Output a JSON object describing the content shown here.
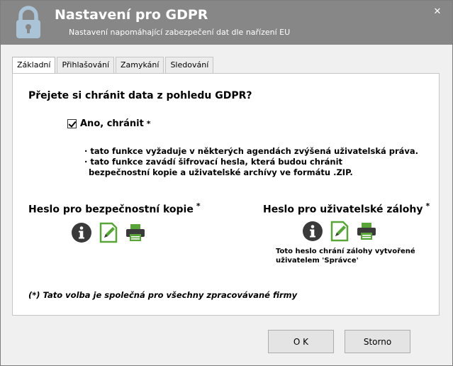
{
  "window": {
    "title": "Nastavení pro GDPR",
    "subtitle": "Nastavení napomáhající zabezpečení dat dle nařízení EU",
    "close_label": "✕"
  },
  "tabs": [
    {
      "label": "Základní",
      "active": true
    },
    {
      "label": "Přihlašování",
      "active": false
    },
    {
      "label": "Zamykání",
      "active": false
    },
    {
      "label": "Sledování",
      "active": false
    }
  ],
  "main": {
    "question": "Přejete si chránit data z pohledu GDPR?",
    "checkbox": {
      "label": "Ano, chránit",
      "checked": true,
      "marker": "*"
    },
    "notes": [
      "· tato funkce vyžaduje v některých agendách zvýšená uživatelská práva.",
      "· tato funkce zavádí šifrovací hesla, která budou chránit",
      "  bezpečnostní kopie a uživatelské archívy ve formátu .ZIP."
    ],
    "backup": {
      "heading": "Heslo pro bezpečnostní kopie",
      "marker": "*"
    },
    "user": {
      "heading": "Heslo pro uživatelské zálohy",
      "marker": "*",
      "note_line1": "Toto heslo chrání zálohy vytvořené",
      "note_line2": "uživatelem  'Správce'"
    },
    "footnote": "(*) Tato volba je společná pro všechny zpracovávané firmy"
  },
  "buttons": {
    "ok": "O K",
    "cancel": "Storno"
  },
  "icons": {
    "lock": "lock-icon",
    "info": "info-icon",
    "edit": "edit-icon",
    "print": "print-icon"
  },
  "colors": {
    "titlebar": "#878787",
    "lock": "#aac3d6",
    "icon_dark": "#3a3a3a",
    "icon_green": "#5aa53a"
  }
}
